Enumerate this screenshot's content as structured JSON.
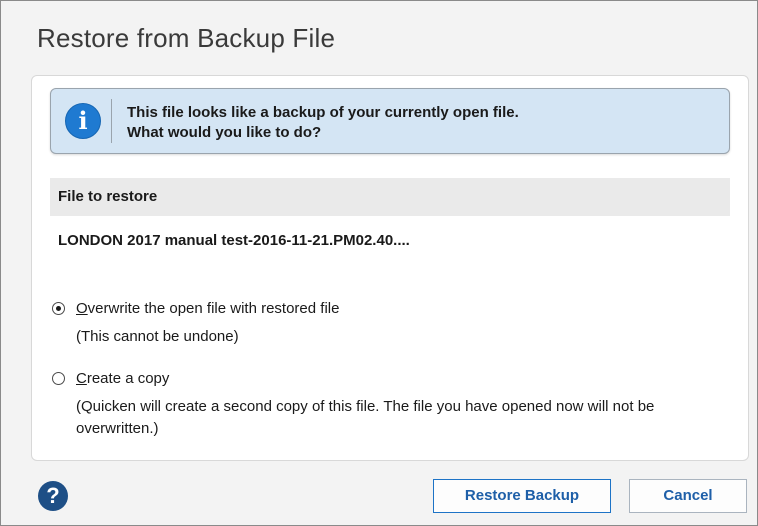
{
  "dialog": {
    "title": "Restore from Backup File"
  },
  "info": {
    "line1": "This file looks like a backup of your currently open file.",
    "line2": "What would you like to do?"
  },
  "file_section": {
    "header": "File to restore",
    "file_name": "LONDON 2017 manual test-2016-11-21.PM02.40...."
  },
  "options": {
    "overwrite": {
      "mnemonic": "O",
      "label_rest": "verwrite the open file with restored file",
      "description": "(This cannot be undone)",
      "selected": true
    },
    "copy": {
      "mnemonic": "C",
      "label_rest": "reate a copy",
      "description": "(Quicken will create a second copy of this file. The file you have opened now will not be overwritten.)",
      "selected": false
    }
  },
  "buttons": {
    "restore": "Restore Backup",
    "cancel": "Cancel"
  },
  "icons": {
    "info": "info-icon",
    "help": "help-icon"
  }
}
